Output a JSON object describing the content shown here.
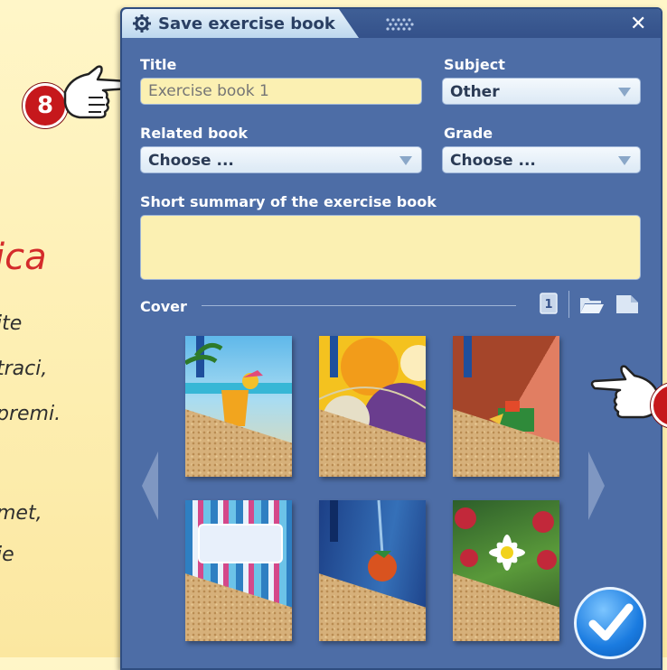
{
  "background_text": {
    "title": "ica",
    "lines": [
      "ite",
      "traci,",
      "premi.",
      "met,",
      "je"
    ]
  },
  "badges": {
    "left": "8"
  },
  "dialog": {
    "title": "Save exercise book",
    "close_glyph": "✕",
    "fields": {
      "title_label": "Title",
      "title_placeholder": "Exercise book 1",
      "subject_label": "Subject",
      "subject_value": "Other",
      "related_label": "Related book",
      "related_value": "Choose ...",
      "grade_label": "Grade",
      "grade_value": "Choose ...",
      "summary_label": "Short summary of the exercise book",
      "summary_value": ""
    },
    "cover": {
      "label": "Cover",
      "page_number": "1",
      "thumbnails": [
        {
          "name": "beach-cocktail",
          "colors": [
            "#3aa5d9",
            "#f4c542"
          ]
        },
        {
          "name": "yellow-abstract",
          "colors": [
            "#f2b21b",
            "#6d3c8c"
          ]
        },
        {
          "name": "brown-parrot",
          "colors": [
            "#a54a2c",
            "#d9785a"
          ]
        },
        {
          "name": "colorful-stripes",
          "colors": [
            "#2a7fc1",
            "#d84b8b"
          ]
        },
        {
          "name": "blue-strawberry",
          "colors": [
            "#2a5ca3",
            "#e05a22"
          ]
        },
        {
          "name": "daisy-raspberries",
          "colors": [
            "#3d7a2a",
            "#c2283a"
          ]
        }
      ]
    }
  },
  "colors": {
    "dialog_bg": "#4d6da6",
    "accent": "#c6181c",
    "input_yellow": "#fbf0b2"
  }
}
